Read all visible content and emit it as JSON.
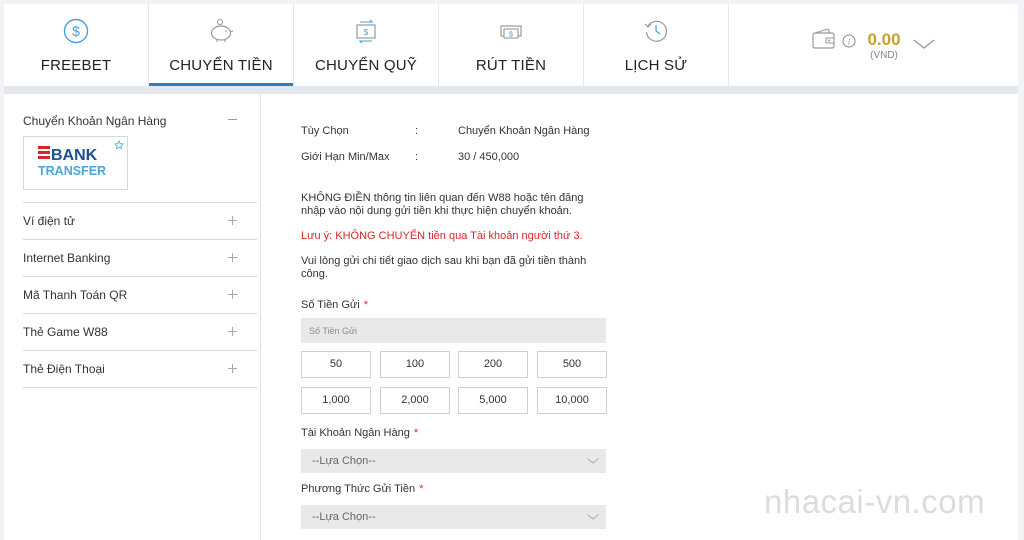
{
  "tabs": [
    {
      "label": "FREEBET",
      "icon": "dollar-coin-icon",
      "active": false
    },
    {
      "label": "CHUYỂN TIỀN",
      "icon": "piggy-bank-icon",
      "active": true
    },
    {
      "label": "CHUYỂN QUỸ",
      "icon": "money-transfer-icon",
      "active": false
    },
    {
      "label": "RÚT TIỀN",
      "icon": "cash-withdraw-icon",
      "active": false
    },
    {
      "label": "LỊCH SỬ",
      "icon": "history-clock-icon",
      "active": false
    }
  ],
  "balance": {
    "amount": "0.00",
    "currency": "(VND)"
  },
  "sidebar": {
    "active_method": "Chuyển Khoản Ngân Hàng",
    "bank_logo": {
      "line1": "BANK",
      "line2": "TRANSFER"
    },
    "items": [
      {
        "label": "Ví điện tử"
      },
      {
        "label": "Internet Banking"
      },
      {
        "label": "Mã Thanh Toán QR"
      },
      {
        "label": "Thẻ Game W88"
      },
      {
        "label": "Thẻ Điện Thoại"
      }
    ]
  },
  "details": {
    "option_label": "Tùy Chọn",
    "option_value": "Chuyển Khoản Ngân Hàng",
    "limit_label": "Giới Hạn Min/Max",
    "limit_value": "30 / 450,000",
    "separator": ":"
  },
  "notice": {
    "para1": "KHÔNG ĐIỀN thông tin liên quan đến W88 hoặc tên đăng nhập vào nội dung gửi tiền khi thực hiện chuyển khoản.",
    "warning": "Lưu ý: KHÔNG CHUYỂN tiền qua Tài khoản người thứ 3.",
    "para2": "Vui lòng gửi chi tiết giao dịch sau khi bạn đã gửi tiền thành công."
  },
  "form": {
    "amount_label": "Số Tiền Gửi",
    "amount_placeholder": "Số Tiền Gửi",
    "required_mark": "*",
    "quick_amounts": [
      "50",
      "100",
      "200",
      "500",
      "1,000",
      "2,000",
      "5,000",
      "10,000"
    ],
    "bank_account_label": "Tài Khoản Ngân Hàng",
    "bank_account_value": "--Lựa Chọn--",
    "deposit_method_label": "Phương Thức Gửi Tiền",
    "deposit_method_value": "--Lựa Chọn--"
  },
  "watermark": "nhacai-vn.com",
  "colors": {
    "accent": "#2b7fc4",
    "balance": "#c9a028",
    "warning": "#d8262b"
  }
}
